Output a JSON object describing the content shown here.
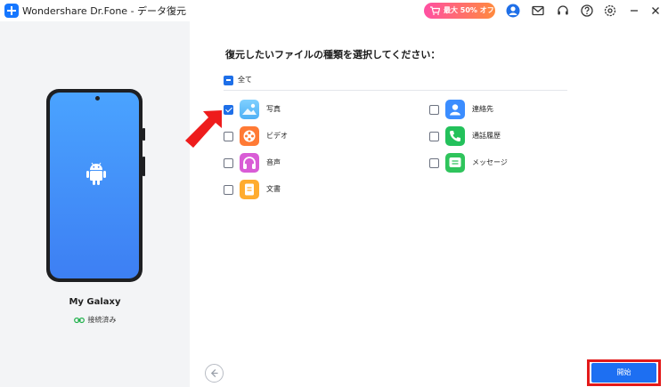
{
  "titlebar": {
    "app_title": "Wondershare Dr.Fone - データ復元",
    "promo_label": "最大 50% オフ"
  },
  "device": {
    "name": "My Galaxy",
    "status": "接続済み"
  },
  "main": {
    "heading": "復元したいファイルの種類を選択してください：",
    "select_all_label": "全て",
    "file_types": [
      {
        "label": "写真",
        "checked": true
      },
      {
        "label": "ビデオ",
        "checked": false
      },
      {
        "label": "音声",
        "checked": false
      },
      {
        "label": "文書",
        "checked": false
      },
      {
        "label": "連絡先",
        "checked": false
      },
      {
        "label": "通話履歴",
        "checked": false
      },
      {
        "label": "メッセージ",
        "checked": false
      }
    ]
  },
  "footer": {
    "start_label": "開始"
  },
  "colors": {
    "accent": "#1d6ff2",
    "highlight": "#e31a1a"
  }
}
